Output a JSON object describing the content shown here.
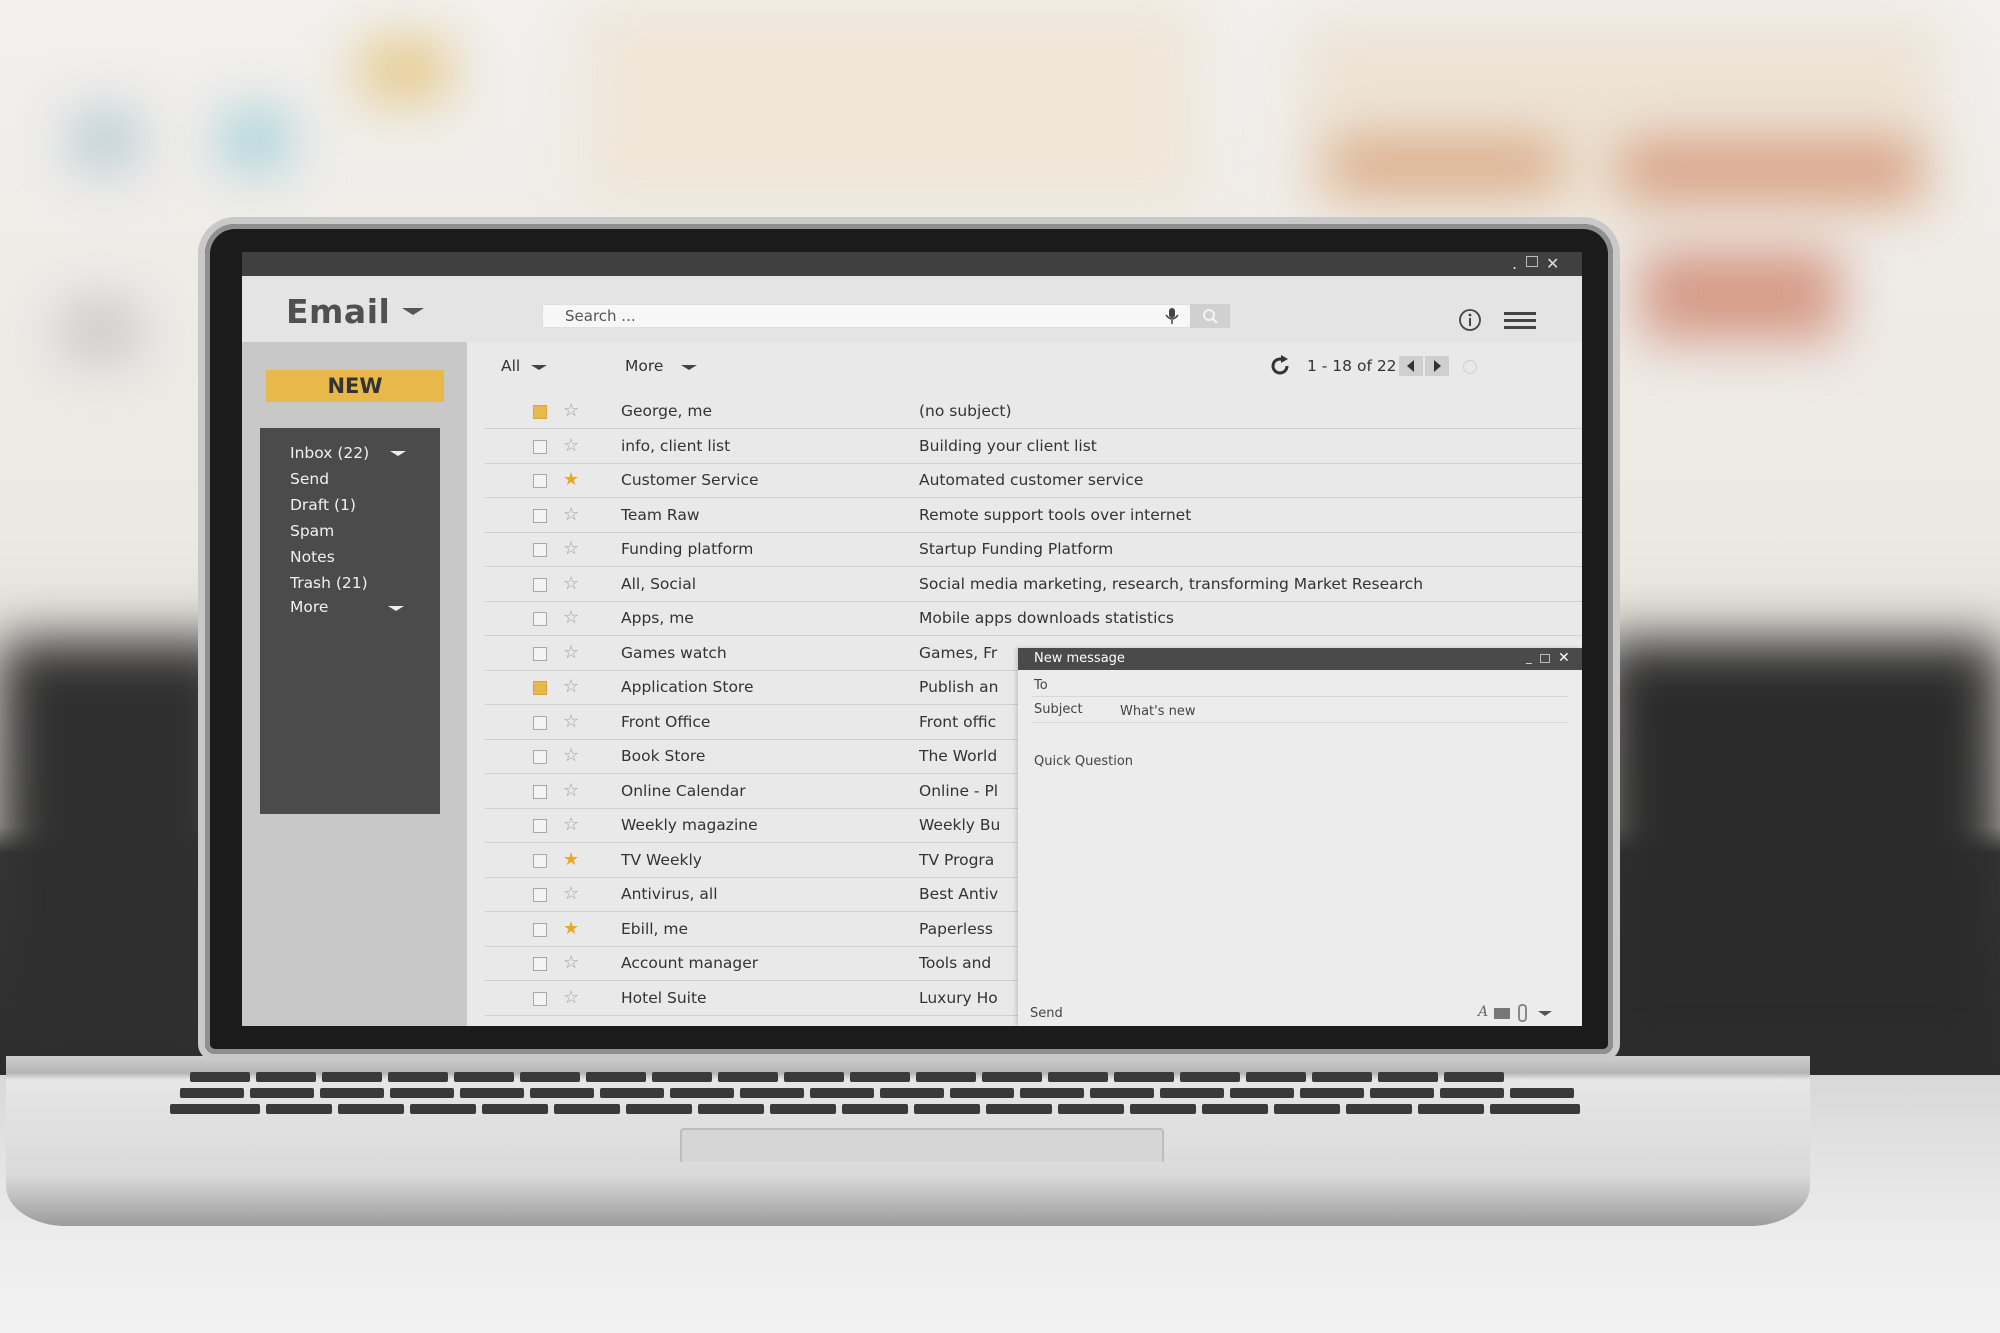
{
  "window": {
    "controls": [
      "minimize",
      "maximize",
      "close"
    ]
  },
  "header": {
    "logo": "Email",
    "search_placeholder": "Search ...",
    "icons": [
      "chevron-down-icon",
      "microphone-icon",
      "search-icon",
      "info-icon",
      "menu-icon"
    ]
  },
  "sidebar": {
    "new_label": "NEW",
    "folders": [
      {
        "label": "Inbox (22)",
        "has_caret": true
      },
      {
        "label": "Send"
      },
      {
        "label": "Draft (1)"
      },
      {
        "label": "Spam"
      },
      {
        "label": "Notes"
      },
      {
        "label": "Trash (21)"
      },
      {
        "label": "More",
        "has_caret": true
      }
    ],
    "bottom_icons": [
      "swap-arrows-icon",
      "contacts-icon",
      "star-icon"
    ]
  },
  "list": {
    "filter_all": "All",
    "filter_more": "More",
    "pagination": "1 - 18 of 22",
    "rows": [
      {
        "sender": "George, me",
        "subject": "(no subject)",
        "selected": true,
        "starred": false
      },
      {
        "sender": "info, client list",
        "subject": "Building your client list",
        "selected": false,
        "starred": false
      },
      {
        "sender": "Customer Service",
        "subject": "Automated customer service",
        "selected": false,
        "starred": true
      },
      {
        "sender": "Team Raw",
        "subject": "Remote support tools over internet",
        "selected": false,
        "starred": false
      },
      {
        "sender": "Funding platform",
        "subject": "Startup Funding Platform",
        "selected": false,
        "starred": false
      },
      {
        "sender": "All, Social",
        "subject": "Social media marketing, research, transforming Market Research",
        "selected": false,
        "starred": false
      },
      {
        "sender": "Apps, me",
        "subject": "Mobile apps downloads statistics",
        "selected": false,
        "starred": false
      },
      {
        "sender": "Games watch",
        "subject": "Games, Fr",
        "selected": false,
        "starred": false
      },
      {
        "sender": "Application Store",
        "subject": "Publish an",
        "selected": true,
        "starred": false
      },
      {
        "sender": "Front Office",
        "subject": "Front offic",
        "selected": false,
        "starred": false
      },
      {
        "sender": "Book Store",
        "subject": "The World",
        "selected": false,
        "starred": false
      },
      {
        "sender": "Online Calendar",
        "subject": "Online - Pl",
        "selected": false,
        "starred": false
      },
      {
        "sender": "Weekly magazine",
        "subject": "Weekly Bu",
        "selected": false,
        "starred": false
      },
      {
        "sender": "TV Weekly",
        "subject": "TV Progra",
        "selected": false,
        "starred": true
      },
      {
        "sender": "Antivirus, all",
        "subject": "Best Antiv",
        "selected": false,
        "starred": false
      },
      {
        "sender": "Ebill, me",
        "subject": "Paperless",
        "selected": false,
        "starred": true
      },
      {
        "sender": "Account manager",
        "subject": "Tools and",
        "selected": false,
        "starred": false
      },
      {
        "sender": "Hotel Suite",
        "subject": "Luxury Ho",
        "selected": false,
        "starred": false
      }
    ]
  },
  "compose": {
    "title": "New message",
    "to_label": "To",
    "subject_label": "Subject",
    "subject_value": "What's new",
    "body": "Quick Question",
    "send_label": "Send",
    "toolbar_icons": [
      "font-icon",
      "image-icon",
      "attach-icon",
      "chevron-down-icon"
    ]
  },
  "colors": {
    "accent": "#e9b84a",
    "sidebar_dark": "#4b4b4b",
    "titlebar": "#404040"
  }
}
